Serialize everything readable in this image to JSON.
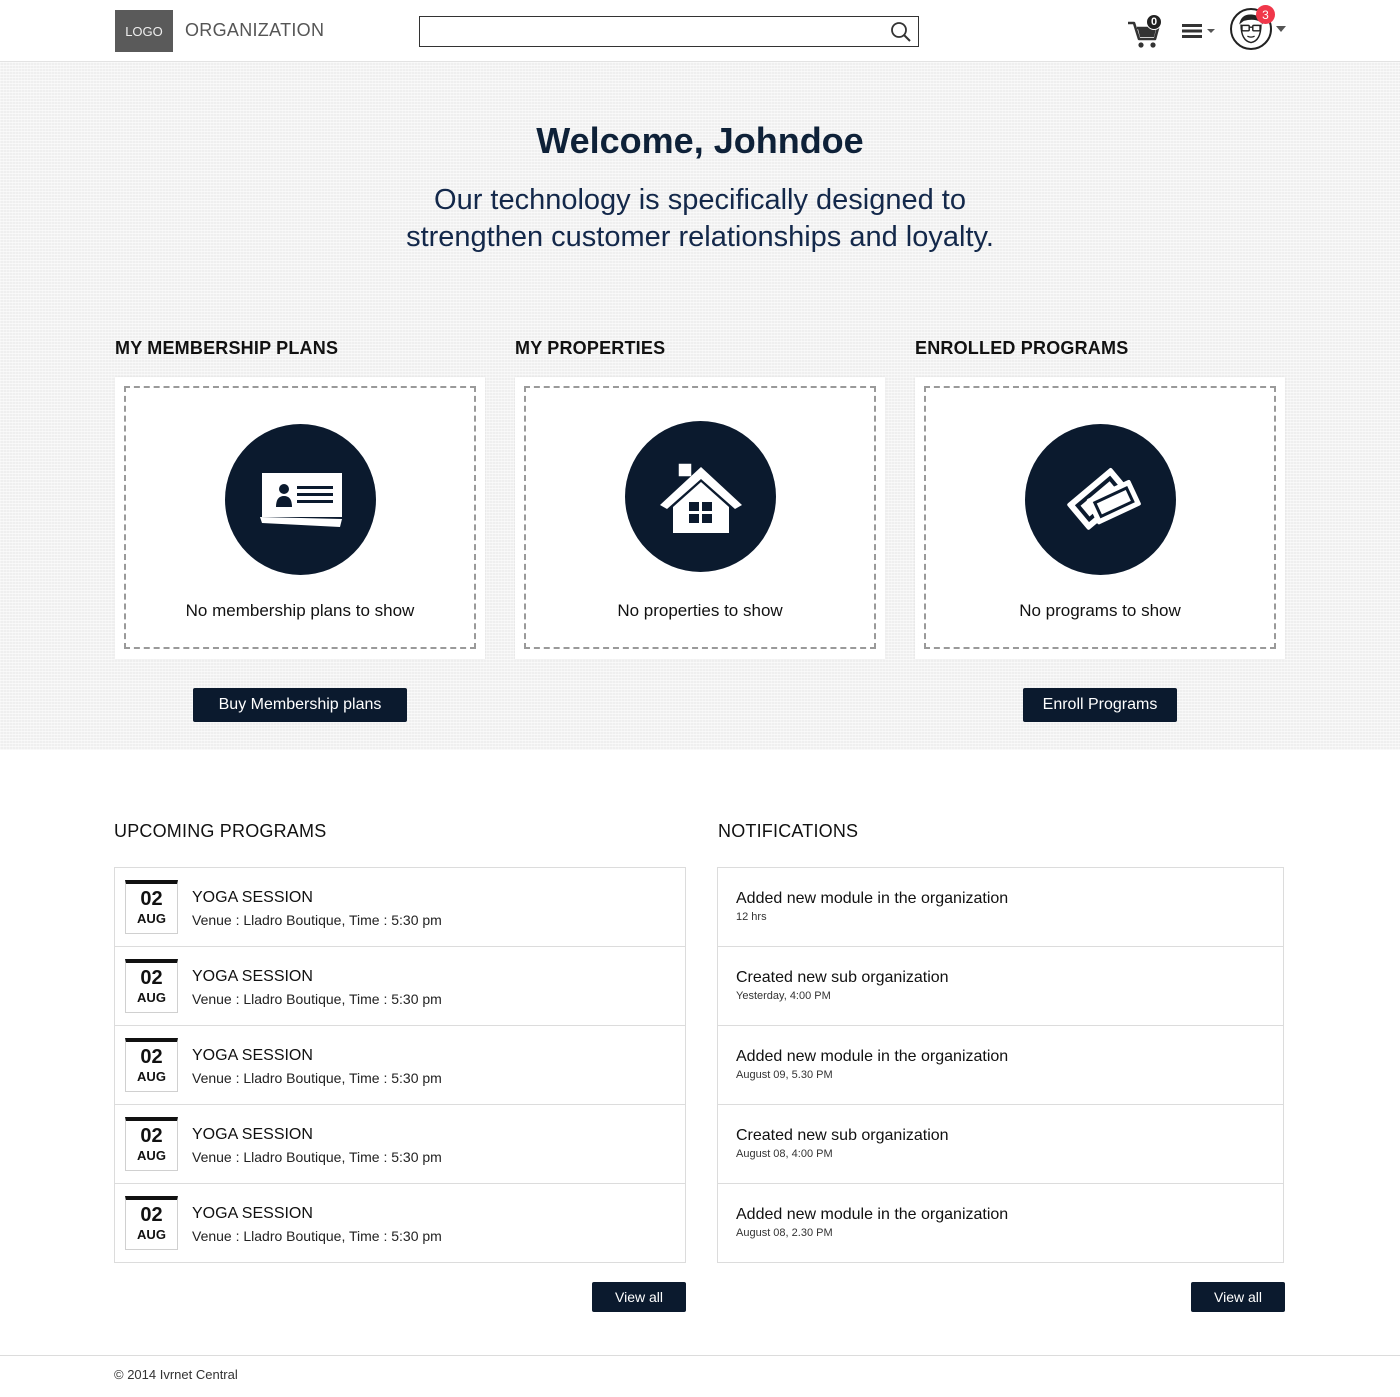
{
  "header": {
    "logo": "LOGO",
    "org_name": "ORGANIZATION",
    "search_placeholder": "",
    "cart_count": "0",
    "notification_count": "3"
  },
  "hero": {
    "welcome": "Welcome, Johndoe",
    "tagline_line1": "Our technology is specifically designed to",
    "tagline_line2": "strengthen customer relationships and loyalty."
  },
  "sections": {
    "membership": {
      "title": "MY MEMBERSHIP PLANS",
      "empty": "No membership plans to show",
      "button": "Buy Membership plans",
      "icon": "id-card-icon"
    },
    "properties": {
      "title": "MY PROPERTIES",
      "empty": "No properties to show",
      "icon": "house-icon"
    },
    "programs": {
      "title": "ENROLLED PROGRAMS",
      "empty": "No programs to show",
      "button": "Enroll Programs",
      "icon": "tickets-icon"
    }
  },
  "upcoming": {
    "title": "UPCOMING PROGRAMS",
    "view_all": "View all",
    "items": [
      {
        "day": "02",
        "month": "AUG",
        "title": "YOGA SESSION",
        "sub": "Venue : Lladro Boutique, Time : 5:30 pm"
      },
      {
        "day": "02",
        "month": "AUG",
        "title": "YOGA SESSION",
        "sub": "Venue : Lladro Boutique, Time : 5:30 pm"
      },
      {
        "day": "02",
        "month": "AUG",
        "title": "YOGA SESSION",
        "sub": "Venue : Lladro Boutique, Time : 5:30 pm"
      },
      {
        "day": "02",
        "month": "AUG",
        "title": "YOGA SESSION",
        "sub": "Venue : Lladro Boutique, Time : 5:30 pm"
      },
      {
        "day": "02",
        "month": "AUG",
        "title": "YOGA SESSION",
        "sub": "Venue : Lladro Boutique, Time : 5:30 pm"
      }
    ]
  },
  "notifications": {
    "title": "NOTIFICATIONS",
    "view_all": "View all",
    "items": [
      {
        "text": "Added new module in the organization",
        "time": "12 hrs"
      },
      {
        "text": "Created new sub organization",
        "time": "Yesterday, 4:00 PM"
      },
      {
        "text": "Added new module in the organization",
        "time": "August 09, 5.30 PM"
      },
      {
        "text": "Created new sub organization",
        "time": "August 08, 4:00 PM"
      },
      {
        "text": "Added new module in the organization",
        "time": "August 08, 2.30 PM"
      }
    ]
  },
  "footer": {
    "copyright": "© 2014 Ivrnet Central"
  },
  "colors": {
    "navy": "#0b1a2e",
    "badge_red": "#f0374a"
  }
}
